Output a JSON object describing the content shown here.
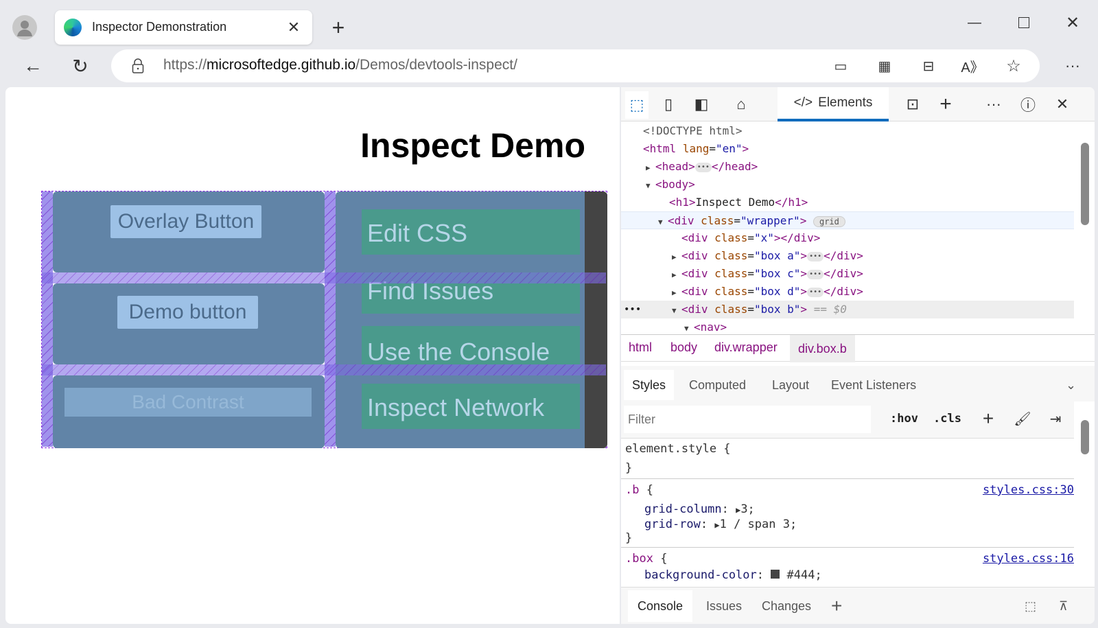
{
  "browser": {
    "tab_title": "Inspector Demonstration",
    "url_host": "https://microsoftedge.github.io",
    "url_scheme": "https://",
    "url_domain": "microsoftedge.github.io",
    "url_path": "/Demos/devtools-inspect/"
  },
  "page": {
    "heading": "Inspect Demo",
    "buttons": [
      "Overlay Button",
      "Demo button",
      "Bad Contrast"
    ],
    "nav_links": [
      "Edit CSS",
      "Find Issues",
      "Use the Console",
      "Inspect Network"
    ]
  },
  "devtools": {
    "toolbar": {
      "elements_tab": "Elements"
    },
    "dom": {
      "doctype": "<!DOCTYPE html>",
      "html_open": "<html",
      "lang_attr": "lang",
      "lang_val": "\"en\"",
      "head_open": "<head>",
      "head_close": "</head>",
      "body_open": "<body>",
      "h1_open": "<h1>",
      "h1_text": "Inspect Demo",
      "h1_close": "</h1>",
      "div_open": "<div",
      "class_attr": "class",
      "wrapper_val": "\"wrapper\"",
      "grid_badge": "grid",
      "x_val": "\"x\"",
      "div_close": "</div>",
      "box_a": "\"box a\"",
      "box_c": "\"box c\"",
      "box_d": "\"box d\"",
      "box_b": "\"box b\"",
      "selected_marker": "== $0",
      "nav_open": "<nav>"
    },
    "breadcrumbs": [
      "html",
      "body",
      "div.wrapper",
      "div.box.b"
    ],
    "styles_tabs": [
      "Styles",
      "Computed",
      "Layout",
      "Event Listeners"
    ],
    "filter_placeholder": "Filter",
    "hov": ":hov",
    "cls": ".cls",
    "rules": {
      "element_style": "element.style {",
      "close_brace": "}",
      "b_selector": ".b",
      "b_source": "styles.css:30",
      "b_props": [
        {
          "name": "grid-column",
          "value": "3;"
        },
        {
          "name": "grid-row",
          "value": "1 / span 3;"
        }
      ],
      "box_selector": ".box",
      "box_source": "styles.css:16",
      "box_prop": {
        "name": "background-color",
        "value": "#444;"
      }
    },
    "drawer_tabs": [
      "Console",
      "Issues",
      "Changes"
    ]
  },
  "colors": {
    "accent": "#0f6cbd",
    "box": "#6184a7",
    "nav_button": "#4a9a8c",
    "grid_gap": "#8f7ee6"
  }
}
